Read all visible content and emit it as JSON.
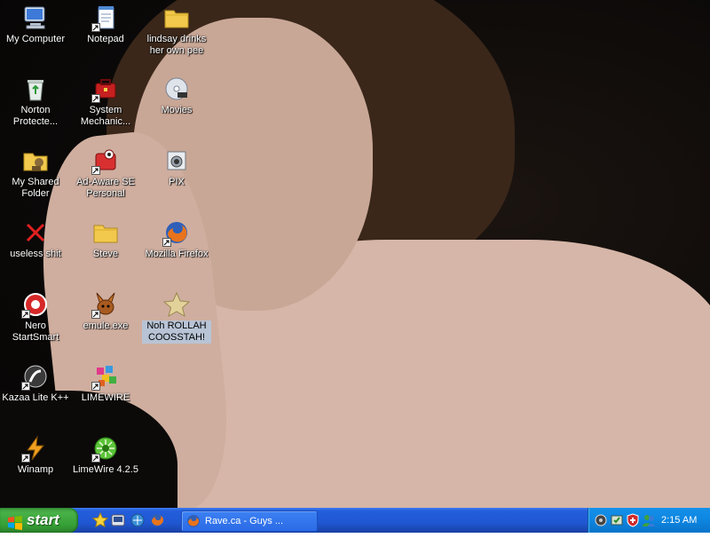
{
  "desktop_icons": [
    {
      "label": "My Computer",
      "icon": "computer-icon"
    },
    {
      "label": "Notepad",
      "icon": "notepad-icon"
    },
    {
      "label": "lindsay drinks her own pee",
      "icon": "folder-icon"
    },
    {
      "label": "Norton Protecte...",
      "icon": "recycle-bin-icon"
    },
    {
      "label": "System Mechanic...",
      "icon": "toolbox-icon"
    },
    {
      "label": "Movies",
      "icon": "dvd-icon"
    },
    {
      "label": "My Shared Folder",
      "icon": "shared-folder-icon"
    },
    {
      "label": "Ad-Aware SE Personal",
      "icon": "adaware-icon"
    },
    {
      "label": "PIX",
      "icon": "camera-icon"
    },
    {
      "label": "useless shit",
      "icon": "red-x-icon"
    },
    {
      "label": "Steve",
      "icon": "folder-icon"
    },
    {
      "label": "Mozilla Firefox",
      "icon": "firefox-icon"
    },
    {
      "label": "Nero StartSmart",
      "icon": "nero-icon"
    },
    {
      "label": "emule.exe",
      "icon": "emule-icon"
    },
    {
      "label": "Noh ROLLAH COOSSTAH!",
      "icon": "star-icon"
    },
    {
      "label": "Kazaa Lite K++",
      "icon": "kazaa-icon"
    },
    {
      "label": "LIMEWIRE",
      "icon": "limewire-cubes-icon"
    },
    {
      "label": "Winamp",
      "icon": "winamp-icon"
    },
    {
      "label": "LimeWire 4.2.5",
      "icon": "limewire-icon"
    }
  ],
  "taskbar": {
    "start_label": "start",
    "quick_launch": [
      "star-icon",
      "media-icon",
      "ie-icon",
      "firefox-icon"
    ],
    "tasks": [
      {
        "label": "Rave.ca - Guys ...",
        "icon": "firefox-icon"
      }
    ],
    "tray_icons": [
      "network-icon",
      "antivirus-icon",
      "shield-icon",
      "messenger-icon"
    ],
    "clock": "2:15 AM"
  },
  "colors": {
    "taskbar_blue": "#245edb",
    "start_green": "#3c9a3c",
    "tray_blue": "#0d86e1",
    "selection": "#b8c4d6"
  }
}
